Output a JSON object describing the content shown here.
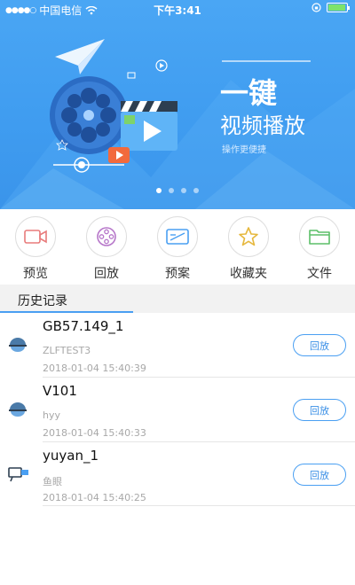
{
  "status_bar": {
    "carrier": "中国电信",
    "time": "下午3:41"
  },
  "banner": {
    "title_line1": "一键",
    "title_line2": "视频播放",
    "subtitle": "操作更便捷",
    "page_count": 4,
    "active_page": 0
  },
  "quick_nav": [
    {
      "id": "preview",
      "label": "预览",
      "icon": "video-camera-icon",
      "color": "#e87b7b"
    },
    {
      "id": "playback",
      "label": "回放",
      "icon": "film-reel-icon",
      "color": "#b676c9"
    },
    {
      "id": "plan",
      "label": "预案",
      "icon": "plan-card-icon",
      "color": "#4a9ff2"
    },
    {
      "id": "favorites",
      "label": "收藏夹",
      "icon": "star-icon",
      "color": "#e6b83e"
    },
    {
      "id": "files",
      "label": "文件",
      "icon": "folder-icon",
      "color": "#5cbf68"
    }
  ],
  "history": {
    "title": "历史记录",
    "items": [
      {
        "name": "GB57.149_1",
        "sub": "ZLFTEST3",
        "time": "2018-01-04 15:40:39",
        "icon": "dome-camera-icon",
        "action": "回放"
      },
      {
        "name": "V101",
        "sub": "hyy",
        "time": "2018-01-04 15:40:33",
        "icon": "dome-camera-icon",
        "action": "回放"
      },
      {
        "name": "yuyan_1",
        "sub": "鱼眼",
        "time": "2018-01-04 15:40:25",
        "icon": "fisheye-camera-icon",
        "action": "回放"
      }
    ]
  },
  "colors": {
    "accent": "#4a9ff2",
    "banner": "#3f9cf0"
  }
}
